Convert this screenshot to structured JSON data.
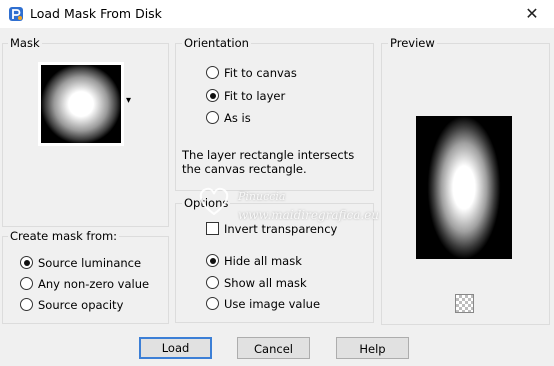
{
  "window": {
    "title": "Load Mask From Disk",
    "close_glyph": "✕"
  },
  "mask_group": {
    "label": "Mask",
    "dropdown_glyph": "▾"
  },
  "orientation": {
    "label": "Orientation",
    "options": [
      {
        "label": "Fit to canvas",
        "checked": false
      },
      {
        "label": "Fit to layer",
        "checked": true
      },
      {
        "label": "As is",
        "checked": false
      }
    ],
    "note": "The layer rectangle intersects the canvas rectangle."
  },
  "preview": {
    "label": "Preview"
  },
  "options_group": {
    "label": "Options",
    "invert": {
      "label": "Invert transparency",
      "checked": false
    },
    "radios": [
      {
        "label": "Hide all mask",
        "checked": true
      },
      {
        "label": "Show all mask",
        "checked": false
      },
      {
        "label": "Use image value",
        "checked": false
      }
    ]
  },
  "create_mask": {
    "label": "Create mask from:",
    "options": [
      {
        "label": "Source luminance",
        "checked": true
      },
      {
        "label": "Any non-zero value",
        "checked": false
      },
      {
        "label": "Source opacity",
        "checked": false
      }
    ]
  },
  "buttons": {
    "load": "Load",
    "cancel": "Cancel",
    "help": "Help"
  },
  "watermark": {
    "name": "Pinuccia",
    "site": "www.maidiregrafica.eu"
  }
}
